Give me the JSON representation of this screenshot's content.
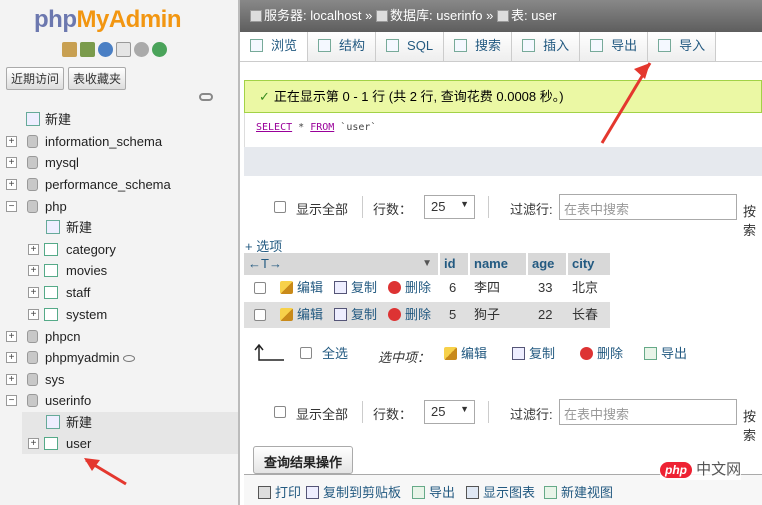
{
  "sidebar": {
    "logo_php": "php",
    "logo_myadmin": "MyAdmin",
    "recent_button": "近期访问",
    "favorites_button": "表收藏夹",
    "tree": {
      "new": "新建",
      "information_schema": "information_schema",
      "mysql": "mysql",
      "performance_schema": "performance_schema",
      "php": "php",
      "php_new": "新建",
      "category": "category",
      "movies": "movies",
      "staff": "staff",
      "system": "system",
      "phpcn": "phpcn",
      "phpmyadmin": "phpmyadmin",
      "sys": "sys",
      "userinfo": "userinfo",
      "userinfo_new": "新建",
      "user": "user"
    }
  },
  "breadcrumb": {
    "server": "服务器: localhost",
    "database": "数据库: userinfo",
    "table": "表: user",
    "sep": "»"
  },
  "tabs": [
    "浏览",
    "结构",
    "SQL",
    "搜索",
    "插入",
    "导出",
    "导入"
  ],
  "success_message": "正在显示第 0 - 1 行 (共 2 行, 查询花费 0.0008 秒。)",
  "sql": {
    "select": "SELECT",
    "rest": " * ",
    "from": "FROM",
    "table": " `user`"
  },
  "nav": {
    "show_all": "显示全部",
    "rows_label": "行数：",
    "rows_value": "25",
    "filter_label": "过滤行:",
    "filter_placeholder": "在表中搜索",
    "sort_by": "按索"
  },
  "options_link": "+ 选项",
  "table": {
    "columns": [
      "id",
      "name",
      "age",
      "city"
    ],
    "rows": [
      {
        "id": "6",
        "name": "李四",
        "age": "33",
        "city": "北京"
      },
      {
        "id": "5",
        "name": "狗子",
        "age": "22",
        "city": "长春"
      }
    ],
    "actions": {
      "edit": "编辑",
      "copy": "复制",
      "delete": "删除"
    }
  },
  "bulk": {
    "select_all": "全选",
    "with_selected": "选中项：",
    "edit": "编辑",
    "copy": "复制",
    "delete": "删除",
    "export": "导出"
  },
  "query_ops": {
    "legend": "查询结果操作",
    "print": "打印",
    "copy_clipboard": "复制到剪贴板",
    "export": "导出",
    "chart": "显示图表",
    "new_view": "新建视图"
  },
  "watermark": {
    "logo": "php",
    "text": "中文网"
  }
}
